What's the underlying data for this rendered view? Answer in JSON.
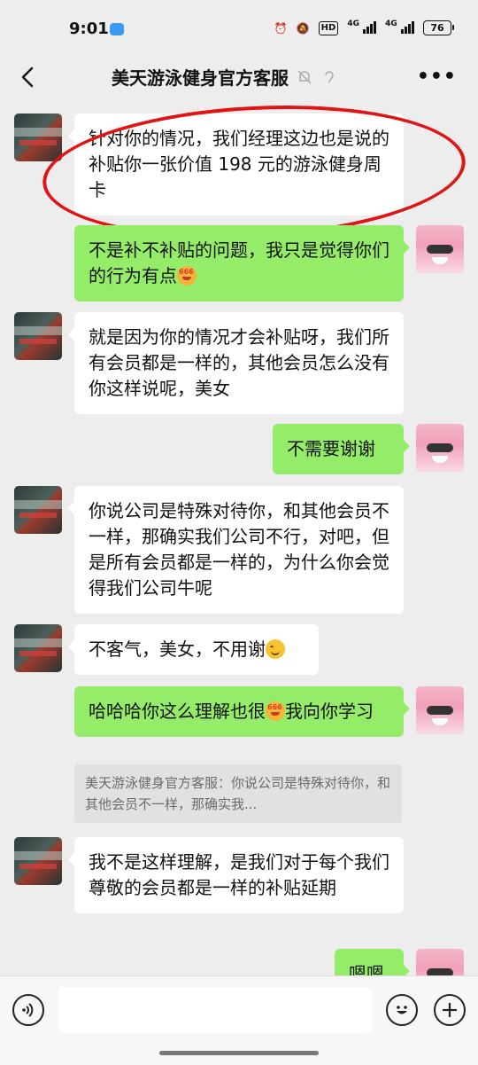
{
  "status_bar": {
    "time": "9:01",
    "hd_label": "HD",
    "net1": "4G",
    "net2": "4G",
    "battery": "76"
  },
  "nav": {
    "title": "美天游泳健身官方客服",
    "more": "•••"
  },
  "messages": [
    {
      "side": "left",
      "text": "针对你的情况，我们经理这边也是说的补贴你一张价值 198 元的游泳健身周卡"
    },
    {
      "side": "right",
      "text": "不是补不补贴的问题，我只是觉得你们的行为有点",
      "emoji": "666-emoji"
    },
    {
      "side": "left",
      "text": "就是因为你的情况才会补贴呀，我们所有会员都是一样的，其他会员怎么没有你这样说呢，美女"
    },
    {
      "side": "right",
      "text": "不需要谢谢"
    },
    {
      "side": "left",
      "text": "你说公司是特殊对待你，和其他会员不一样，那确实我们公司不行，对吧，但是所有会员都是一样的，为什么你会觉得我们公司牛呢"
    },
    {
      "side": "left",
      "text": "不客气，美女，不用谢",
      "emoji": "smile-emoji"
    },
    {
      "side": "right",
      "text_before": "哈哈哈你这么理解也很",
      "text_after": "我向你学习",
      "emoji": "666-emoji"
    },
    {
      "side": "left",
      "text": "我不是这样理解，是我们对于每个我们尊敬的会员都是一样的补贴延期"
    },
    {
      "side": "right",
      "text": "嗯嗯"
    }
  ],
  "quote": {
    "text": "美天游泳健身官方客服：你说公司是特殊对待你，和其他会员不一样，那确实我..."
  },
  "emoji_badge": "666",
  "colors": {
    "self_bubble": "#95ec69",
    "other_bubble": "#ffffff",
    "background": "#ededed",
    "annotation": "#e01414"
  }
}
